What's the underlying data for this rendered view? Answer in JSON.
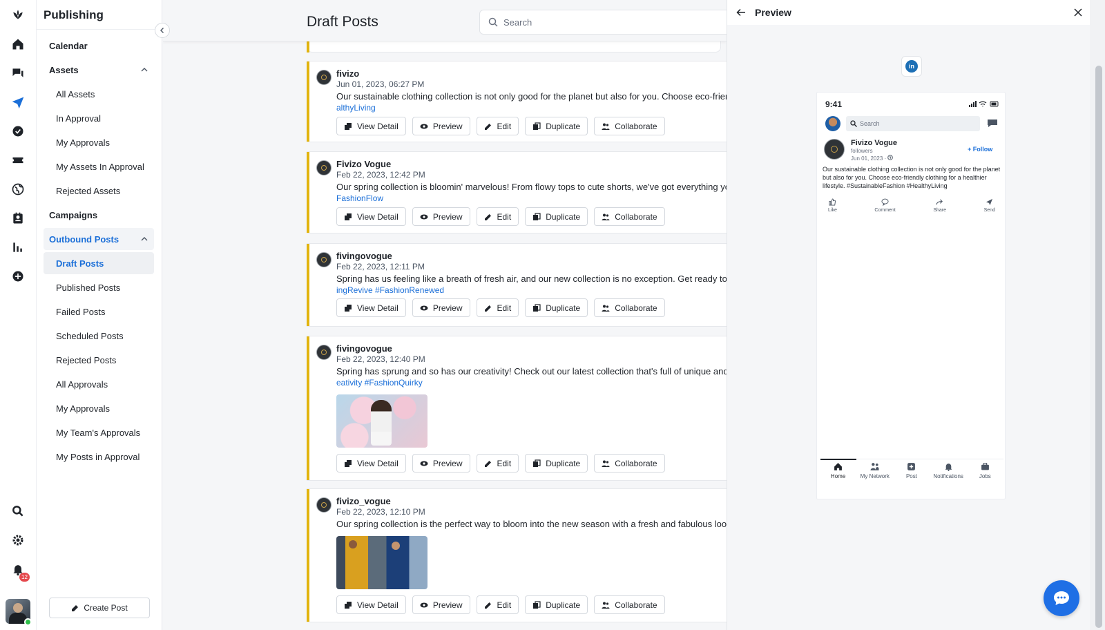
{
  "nav": {
    "title": "Publishing",
    "items": [
      {
        "label": "Calendar"
      },
      {
        "label": "Assets"
      },
      {
        "label": "All Assets"
      },
      {
        "label": "In Approval"
      },
      {
        "label": "My Approvals"
      },
      {
        "label": "My Assets In Approval"
      },
      {
        "label": "Rejected Assets"
      },
      {
        "label": "Campaigns"
      },
      {
        "label": "Outbound Posts"
      },
      {
        "label": "Draft Posts"
      },
      {
        "label": "Published Posts"
      },
      {
        "label": "Failed Posts"
      },
      {
        "label": "Scheduled Posts"
      },
      {
        "label": "Rejected Posts"
      },
      {
        "label": "All Approvals"
      },
      {
        "label": "My Approvals"
      },
      {
        "label": "My Team's Approvals"
      },
      {
        "label": "My Posts in Approval"
      }
    ],
    "create_post": "Create Post",
    "notification_count": "12"
  },
  "main": {
    "title": "Draft Posts",
    "search_placeholder": "Search",
    "actions": {
      "view_detail": "View Detail",
      "preview": "Preview",
      "edit": "Edit",
      "duplicate": "Duplicate",
      "collaborate": "Collaborate"
    },
    "posts": [
      {
        "author": "fivizo",
        "date": "Jun 01, 2023, 06:27 PM",
        "text": "Our sustainable clothing collection is not only good for the planet but also for you. Choose eco-friendly cl",
        "tags": "althyLiving"
      },
      {
        "author": "Fivizo Vogue",
        "date": "Feb 22, 2023, 12:42 PM",
        "text": "Our spring collection is bloomin' marvelous! From flowy tops to cute shorts, we've got everything you nee",
        "tags": "FashionFlow"
      },
      {
        "author": "fivingovogue",
        "date": "Feb 22, 2023, 12:11 PM",
        "text": "Spring has us feeling like a breath of fresh air, and our new collection is no exception. Get ready to feel re",
        "tags": "ingRevive #FashionRenewed"
      },
      {
        "author": "fivingovogue",
        "date": "Feb 22, 2023, 12:40 PM",
        "text": "Spring has sprung and so has our creativity! Check out our latest collection that's full of unique and quirk",
        "tags": "eativity #FashionQuirky"
      },
      {
        "author": "fivizo_vogue",
        "date": "Feb 22, 2023, 12:10 PM",
        "text": "Our spring collection is the perfect way to bloom into the new season with a fresh and fabulous look.",
        "tags": ""
      }
    ]
  },
  "preview": {
    "title": "Preview",
    "phone": {
      "time": "9:41",
      "search_placeholder": "Search",
      "name": "Fivizo Vogue",
      "followers": "followers",
      "date": "Jun 01, 2023  ·",
      "follow": "+ Follow",
      "text": "Our sustainable clothing collection is not only good for the planet but also for you. Choose eco-friendly clothing for a healthier lifestyle. #SustainableFashion #HealthyLiving",
      "actions": [
        "Like",
        "Comment",
        "Share",
        "Send"
      ],
      "nav": [
        "Home",
        "My Network",
        "Post",
        "Notifications",
        "Jobs"
      ]
    },
    "network_badge": "in"
  },
  "colors": {
    "accent_blue": "#1b6fd8",
    "draft_accent": "#e1b40f",
    "chat_fab": "#1f6fe5",
    "linkedin": "#1d6fb5"
  }
}
